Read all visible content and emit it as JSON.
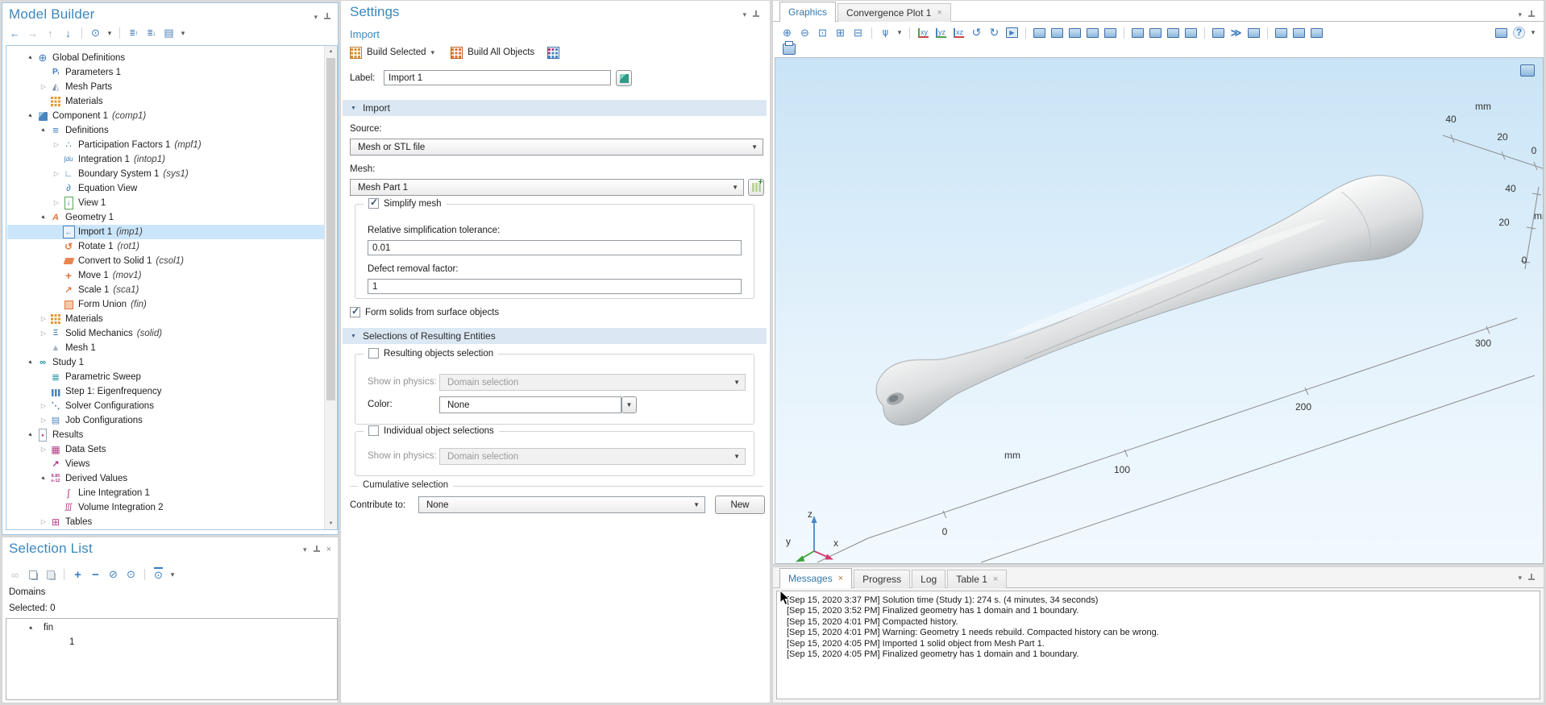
{
  "colors": {
    "accent_title": "#3b87bd",
    "tree_selection": "#cbe6fb",
    "section_header_bg": "#dbe8f4",
    "canvas_top": "#c9e4f6",
    "canvas_bottom": "#f2f9fe",
    "triad_x": "#d63a6e",
    "triad_y": "#3ba33b",
    "triad_z": "#4a86c8"
  },
  "model_builder": {
    "title": "Model Builder",
    "toolbar": [
      "back",
      "forward",
      "move-up",
      "move-down",
      "sep",
      "show",
      "dd",
      "sep",
      "collapse-all",
      "expand-all",
      "go-to-node",
      "dd"
    ],
    "tree": [
      {
        "label": "Global Definitions",
        "tag": "",
        "icon": "globe",
        "level": 0,
        "state": "expanded"
      },
      {
        "label": "Parameters 1",
        "tag": "",
        "icon": "parameters",
        "level": 1,
        "state": ""
      },
      {
        "label": "Mesh Parts",
        "tag": "",
        "icon": "mesh-parts",
        "level": 1,
        "state": "collapsed"
      },
      {
        "label": "Materials",
        "tag": "",
        "icon": "materials",
        "level": 1,
        "state": ""
      },
      {
        "label": "Component 1",
        "tag": "comp1",
        "icon": "component",
        "level": 0,
        "state": "expanded"
      },
      {
        "label": "Definitions",
        "tag": "",
        "icon": "definitions",
        "level": 1,
        "state": "expanded"
      },
      {
        "label": "Participation Factors 1",
        "tag": "mpf1",
        "icon": "participation",
        "level": 2,
        "state": "collapsed"
      },
      {
        "label": "Integration 1",
        "tag": "intop1",
        "icon": "integration",
        "level": 2,
        "state": ""
      },
      {
        "label": "Boundary System 1",
        "tag": "sys1",
        "icon": "boundary-system",
        "level": 2,
        "state": "collapsed"
      },
      {
        "label": "Equation View",
        "tag": "",
        "icon": "equation-view",
        "level": 2,
        "state": ""
      },
      {
        "label": "View 1",
        "tag": "",
        "icon": "view",
        "level": 2,
        "state": "collapsed"
      },
      {
        "label": "Geometry 1",
        "tag": "",
        "icon": "geometry",
        "level": 1,
        "state": "expanded"
      },
      {
        "label": "Import 1",
        "tag": "imp1",
        "icon": "import",
        "level": 2,
        "state": "",
        "selected": true
      },
      {
        "label": "Rotate 1",
        "tag": "rot1",
        "icon": "rotate",
        "level": 2,
        "state": ""
      },
      {
        "label": "Convert to Solid 1",
        "tag": "csol1",
        "icon": "convert-solid",
        "level": 2,
        "state": ""
      },
      {
        "label": "Move 1",
        "tag": "mov1",
        "icon": "move",
        "level": 2,
        "state": ""
      },
      {
        "label": "Scale 1",
        "tag": "sca1",
        "icon": "scale",
        "level": 2,
        "state": ""
      },
      {
        "label": "Form Union",
        "tag": "fin",
        "icon": "form-union",
        "level": 2,
        "state": ""
      },
      {
        "label": "Materials",
        "tag": "",
        "icon": "materials",
        "level": 1,
        "state": "collapsed"
      },
      {
        "label": "Solid Mechanics",
        "tag": "solid",
        "icon": "solid-mechanics",
        "level": 1,
        "state": "collapsed"
      },
      {
        "label": "Mesh 1",
        "tag": "",
        "icon": "mesh",
        "level": 1,
        "state": ""
      },
      {
        "label": "Study 1",
        "tag": "",
        "icon": "study",
        "level": 0,
        "state": "expanded"
      },
      {
        "label": "Parametric Sweep",
        "tag": "",
        "icon": "parametric-sweep",
        "level": 1,
        "state": ""
      },
      {
        "label": "Step 1: Eigenfrequency",
        "tag": "",
        "icon": "study-step",
        "level": 1,
        "state": ""
      },
      {
        "label": "Solver Configurations",
        "tag": "",
        "icon": "solver-config",
        "level": 1,
        "state": "collapsed"
      },
      {
        "label": "Job Configurations",
        "tag": "",
        "icon": "job-config",
        "level": 1,
        "state": "collapsed"
      },
      {
        "label": "Results",
        "tag": "",
        "icon": "results",
        "level": 0,
        "state": "expanded"
      },
      {
        "label": "Data Sets",
        "tag": "",
        "icon": "data-sets",
        "level": 1,
        "state": "collapsed"
      },
      {
        "label": "Views",
        "tag": "",
        "icon": "views",
        "level": 1,
        "state": ""
      },
      {
        "label": "Derived Values",
        "tag": "",
        "icon": "derived-values",
        "level": 1,
        "state": "expanded"
      },
      {
        "label": "Line Integration 1",
        "tag": "",
        "icon": "line-integration",
        "level": 2,
        "state": ""
      },
      {
        "label": "Volume Integration 2",
        "tag": "",
        "icon": "volume-integration",
        "level": 2,
        "state": ""
      },
      {
        "label": "Tables",
        "tag": "",
        "icon": "tables",
        "level": 1,
        "state": "collapsed"
      }
    ]
  },
  "selection_list": {
    "title": "Selection List",
    "toolbar": [
      "link",
      "copy",
      "paste",
      "sep",
      "add",
      "remove",
      "hide",
      "show-sel",
      "sep",
      "zoom-selected-sl",
      "dd"
    ],
    "kind_label": "Domains",
    "selected_label": "Selected: 0",
    "group_label": "fin",
    "group_children": [
      "1"
    ]
  },
  "settings": {
    "title": "Settings",
    "subtitle": "Import",
    "toolbar": {
      "build_selected": "Build Selected",
      "build_all": "Build All Objects"
    },
    "label_row": {
      "label": "Label:",
      "value": "Import 1"
    },
    "import_section": {
      "title": "Import",
      "source_label": "Source:",
      "source_value": "Mesh or STL file",
      "mesh_label": "Mesh:",
      "mesh_value": "Mesh Part 1",
      "simplify_group": {
        "title": "Simplify mesh",
        "checked": true,
        "rel_tol_label": "Relative simplification tolerance:",
        "rel_tol_value": "0.01",
        "defect_label": "Defect removal factor:",
        "defect_value": "1"
      },
      "form_solids_label": "Form solids from surface objects",
      "form_solids_checked": true
    },
    "selections_section": {
      "title": "Selections of Resulting Entities",
      "resulting_group": {
        "title": "Resulting objects selection",
        "checked": false,
        "show_label": "Show in physics:",
        "show_value": "Domain selection",
        "color_label": "Color:",
        "color_value": "None"
      },
      "individual_group": {
        "title": "Individual object selections",
        "checked": false,
        "show_label": "Show in physics:",
        "show_value": "Domain selection"
      },
      "cumulative": {
        "title": "Cumulative selection",
        "contribute_label": "Contribute to:",
        "contribute_value": "None",
        "new_button": "New"
      }
    }
  },
  "graphics": {
    "tabs": [
      {
        "label": "Graphics",
        "active": true,
        "closable": false
      },
      {
        "label": "Convergence Plot 1",
        "active": false,
        "closable": true
      }
    ],
    "toolbar": [
      "zoom-in",
      "zoom-out",
      "zoom-box",
      "zoom-extents",
      "zoom-selected",
      "sep",
      "default-view",
      "dd",
      "sep",
      "xy-view",
      "yz-view",
      "xz-view",
      "rotate-ccw",
      "rotate-cw",
      "movie",
      "sep",
      "scene-light",
      "transparency",
      "show-grid",
      "material-color",
      "wireframe",
      "sep",
      "select-box",
      "select-lasso",
      "deselect",
      "zoom-selection",
      "sep",
      "snapshot",
      "animation",
      "print-plot",
      "sep",
      "hide-selected",
      "reset-hiding",
      "clip-plane",
      "spacer",
      "windows",
      "help",
      "dd"
    ],
    "scene": {
      "x_axis_ticks": [
        "0",
        "100",
        "200",
        "300"
      ],
      "x_axis_unit": "mm",
      "top_ruler_ticks": [
        "40",
        "20",
        "0"
      ],
      "top_ruler_unit": "mm",
      "right_ruler_ticks": [
        "40",
        "20",
        "0"
      ],
      "right_ruler_unit": "mm",
      "triad": {
        "x": "x",
        "y": "y",
        "z": "z"
      }
    }
  },
  "messages": {
    "tabs": [
      {
        "label": "Messages",
        "active": true,
        "closable": true
      },
      {
        "label": "Progress",
        "active": false,
        "closable": false
      },
      {
        "label": "Log",
        "active": false,
        "closable": false
      },
      {
        "label": "Table 1",
        "active": false,
        "closable": true
      }
    ],
    "lines": [
      "[Sep 15, 2020 3:37 PM] Solution time (Study 1): 274 s. (4 minutes, 34 seconds)",
      "[Sep 15, 2020 3:52 PM] Finalized geometry has 1 domain and 1 boundary.",
      "[Sep 15, 2020 4:01 PM] Compacted history.",
      "[Sep 15, 2020 4:01 PM] Warning: Geometry 1 needs rebuild. Compacted history can be wrong.",
      "[Sep 15, 2020 4:05 PM] Imported 1 solid object from Mesh Part 1.",
      "[Sep 15, 2020 4:05 PM] Finalized geometry has 1 domain and 1 boundary."
    ]
  }
}
